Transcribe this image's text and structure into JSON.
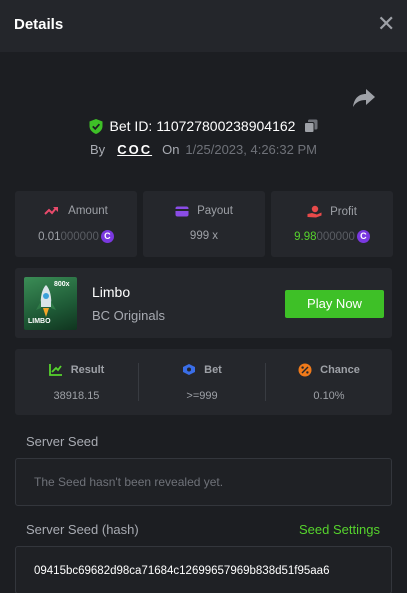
{
  "header": {
    "title": "Details",
    "close_symbol": "✕"
  },
  "bet": {
    "id_label": "Bet ID:",
    "id_value": "110727800238904162",
    "by_label": "By",
    "user": "COC",
    "on_label": "On",
    "date": "1/25/2023, 4:26:32 PM"
  },
  "stats": {
    "amount": {
      "label": "Amount",
      "value_main": "0.01",
      "value_trail": "000000"
    },
    "payout": {
      "label": "Payout",
      "value": "999 x"
    },
    "profit": {
      "label": "Profit",
      "value_main": "9.98",
      "value_trail": "000000"
    }
  },
  "game": {
    "name": "Limbo",
    "provider": "BC Originals",
    "play_label": "Play Now",
    "thumb_text": "LIMBO",
    "thumb_multiplier": "800x"
  },
  "result": {
    "result_label": "Result",
    "result_value": "38918.15",
    "bet_label": "Bet",
    "bet_value": ">=999",
    "chance_label": "Chance",
    "chance_value": "0.10%"
  },
  "seeds": {
    "server_seed_label": "Server Seed",
    "server_seed_text": "The Seed hasn't been revealed yet.",
    "hash_label": "Server Seed (hash)",
    "settings_label": "Seed Settings",
    "hash_value": "09415bc69682d98ca71684c12699657969b838d51f95aa6"
  },
  "colors": {
    "accent_green": "#3ec027",
    "profit_green": "#56d32d",
    "coin_purple": "#7a38e0",
    "background": "#1c1e22",
    "card": "#25272c"
  },
  "icons": {
    "close": "close-icon",
    "share": "share-icon",
    "shield": "shield-check-icon",
    "copy": "copy-icon",
    "amount": "amount-icon",
    "payout": "wallet-icon",
    "profit": "profit-hand-icon",
    "result": "result-chart-icon",
    "bet": "bet-icon",
    "chance": "percent-icon",
    "coin": "coin-icon"
  }
}
